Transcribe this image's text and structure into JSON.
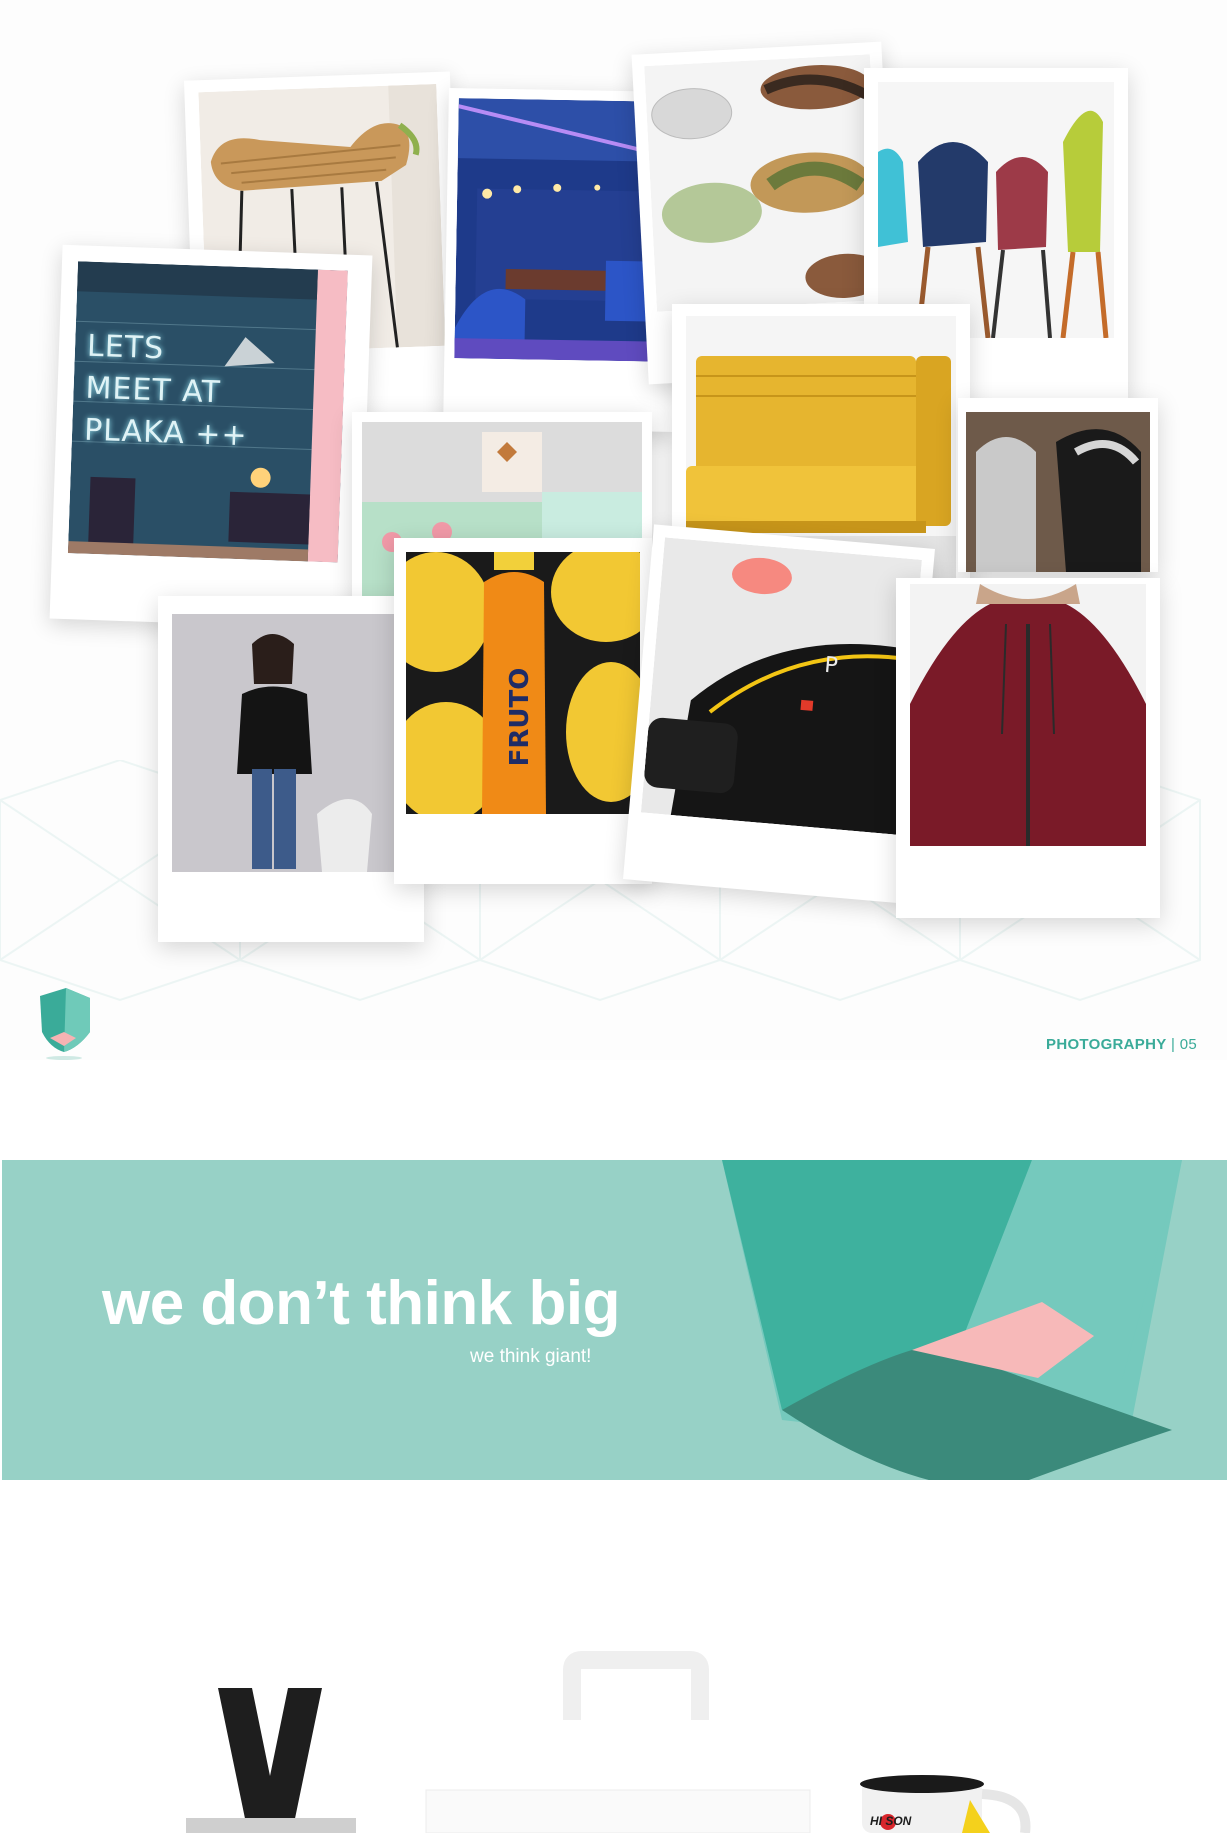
{
  "footer": {
    "section_label": "PHOTOGRAPHY",
    "separator": "|",
    "page_number": "05"
  },
  "banner": {
    "title": "we don’t think big",
    "subtitle": "we think giant!"
  },
  "photos": {
    "neon_sign": "LETS MEET AT PLAKA ++",
    "bottle_brand": "FRUTO",
    "mug_brand": "HI SON"
  },
  "colors": {
    "accent": "#3aab99",
    "banner_bg": "#97d1c6",
    "shape_dark": "#3b8a7b",
    "shape_mid": "#3eb19e",
    "shape_light": "#75c9bd",
    "shape_pink": "#f7b9b9"
  },
  "icons": {
    "logo": "shield-gem-logo"
  }
}
